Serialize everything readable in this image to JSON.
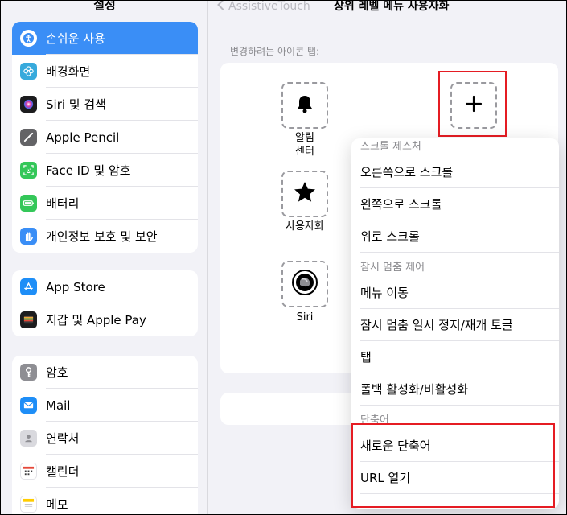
{
  "sidebar": {
    "title": "설정",
    "group1": [
      {
        "label": "손쉬운 사용",
        "icon": "accessibility-icon",
        "color": "#3a8ef6",
        "glyph": "ⓘ",
        "active": true
      },
      {
        "label": "배경화면",
        "icon": "wallpaper-icon",
        "color": "#37aadc",
        "glyph": "✿"
      },
      {
        "label": "Siri 및 검색",
        "icon": "siri-icon",
        "color": "#222222",
        "glyph": "◉"
      },
      {
        "label": "Apple Pencil",
        "icon": "pencil-icon",
        "color": "#636366",
        "glyph": "/"
      },
      {
        "label": "Face ID 및 암호",
        "icon": "face-id-icon",
        "color": "#34c759",
        "glyph": "☺"
      },
      {
        "label": "배터리",
        "icon": "battery-icon",
        "color": "#34c759",
        "glyph": "▬"
      },
      {
        "label": "개인정보 보호 및 보안",
        "icon": "privacy-hand-icon",
        "color": "#3a8ef6",
        "glyph": "✋"
      }
    ],
    "group2": [
      {
        "label": "App Store",
        "icon": "app-store-icon",
        "color": "#1e8ef7",
        "glyph": "A"
      },
      {
        "label": "지갑 및 Apple Pay",
        "icon": "wallet-icon",
        "color": "#1c1c1e",
        "glyph": "▤"
      }
    ],
    "group3": [
      {
        "label": "암호",
        "icon": "key-icon",
        "color": "#8e8e93",
        "glyph": "⚷"
      },
      {
        "label": "Mail",
        "icon": "mail-icon",
        "color": "#1e8ef7",
        "glyph": "✉"
      },
      {
        "label": "연락처",
        "icon": "contacts-icon",
        "color": "#a4a4a8",
        "glyph": "☻"
      },
      {
        "label": "캘린더",
        "icon": "calendar-icon",
        "color": "#ffffff",
        "glyph": "▦"
      },
      {
        "label": "메모",
        "icon": "notes-icon",
        "color": "#ffcc00",
        "glyph": "≡"
      }
    ]
  },
  "nav": {
    "back_label": "AssistiveTouch",
    "title": "상위 레벨 메뉴 사용자화"
  },
  "icons_section": {
    "caption": "변경하려는 아이콘 탭:",
    "slots": [
      {
        "label": "알림\n센터",
        "icon": "bell-icon"
      },
      {
        "label": "",
        "icon": "plus-icon"
      },
      {
        "label": "사용자화",
        "icon": "star-icon"
      },
      {
        "label": "Siri",
        "icon": "siri-orb-icon"
      }
    ]
  },
  "menu": {
    "sections": [
      {
        "header": "스크롤 제스처",
        "items": [
          "오른쪽으로 스크롤",
          "왼쪽으로 스크롤",
          "위로 스크롤"
        ]
      },
      {
        "header": "잠시 멈춤 제어",
        "items": [
          "메뉴 이동",
          "잠시 멈춤 일시 정지/재개 토글",
          "탭",
          "폴백 활성화/비활성화"
        ]
      },
      {
        "header": "단축어",
        "items": [
          "새로운 단축어",
          "URL 열기"
        ]
      }
    ]
  },
  "colors": {
    "accent": "#3a8ef6",
    "highlight": "#e51c23"
  }
}
